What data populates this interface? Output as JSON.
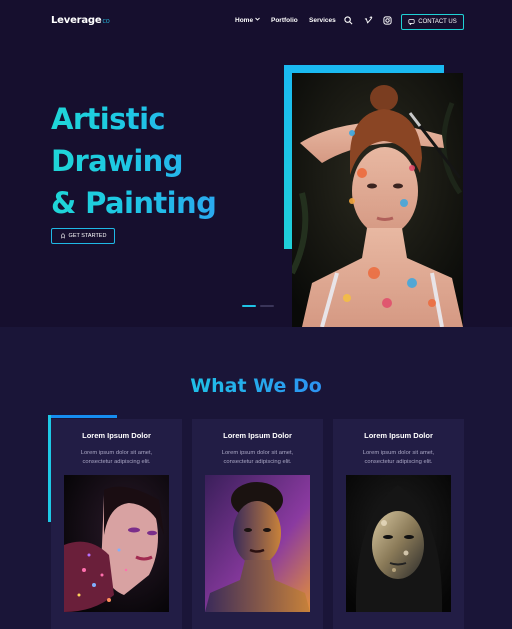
{
  "header": {
    "logo": "Leverage",
    "logo_sup": "CO",
    "nav": [
      {
        "label": "Home"
      },
      {
        "label": "Portfolio"
      },
      {
        "label": "Services"
      }
    ],
    "icons": [
      "search-icon",
      "vimeo-icon",
      "instagram-icon"
    ],
    "contact_label": "CONTACT US"
  },
  "hero": {
    "title_lines": [
      "Artistic",
      "Drawing",
      "& Painting"
    ],
    "cta_label": "GET STARTED",
    "slides": {
      "count": 2,
      "active": 1
    }
  },
  "services": {
    "title": "What We Do",
    "cards": [
      {
        "title": "Lorem Ipsum Dolor",
        "line1": "Lorem ipsum dolor sit amet,",
        "line2": "consectetur adipiscing elit."
      },
      {
        "title": "Lorem Ipsum Dolor",
        "line1": "Lorem ipsum dolor sit amet,",
        "line2": "consectetur adipiscing elit."
      },
      {
        "title": "Lorem Ipsum Dolor",
        "line1": "Lorem ipsum dolor sit amet,",
        "line2": "consectetur adipiscing elit."
      }
    ]
  },
  "colors": {
    "background": "#160f2e",
    "section_background": "#1a1538",
    "card_background": "#221d45",
    "accent_teal": "#1fd6d7",
    "accent_blue": "#168df0"
  }
}
